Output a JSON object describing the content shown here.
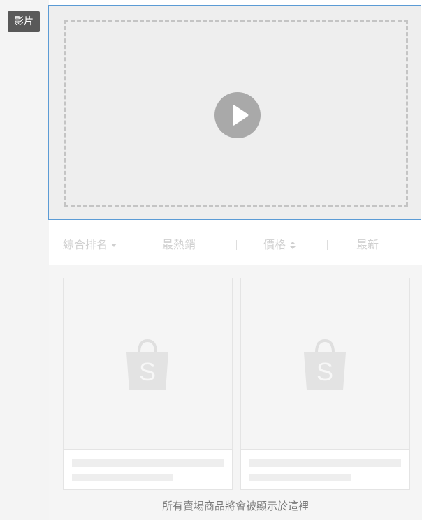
{
  "video_section": {
    "label": "影片",
    "play_icon": "play-circle-icon"
  },
  "sort_bar": {
    "relevance": "綜合排名",
    "top_sales": "最熱銷",
    "price": "價格",
    "latest": "最新"
  },
  "products": [
    {
      "icon": "shopping-bag-icon",
      "letter": "S"
    },
    {
      "icon": "shopping-bag-icon",
      "letter": "S"
    }
  ],
  "footer_note": "所有賣場商品將會被顯示於這裡",
  "colors": {
    "selection_border": "#5b9bd5",
    "label_bg": "#595959",
    "placeholder_gray": "#eeeeee"
  }
}
